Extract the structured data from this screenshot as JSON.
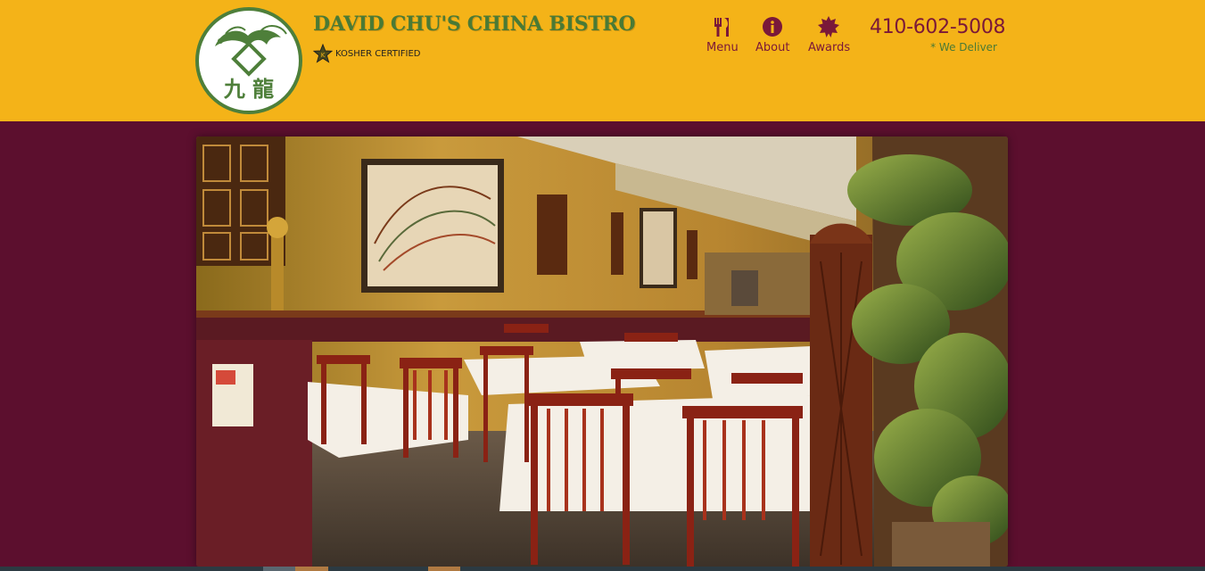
{
  "header": {
    "brand": "DAVID CHU'S CHINA BISTRO",
    "badge": "KOSHER CERTIFIED",
    "phone": "410-602-5008",
    "delivery_note": "* We Deliver"
  },
  "nav": [
    {
      "label": "Menu",
      "icon": "utensils-icon"
    },
    {
      "label": "About",
      "icon": "info-icon"
    },
    {
      "label": "Awards",
      "icon": "award-burst-icon"
    }
  ],
  "logo": {
    "glyphs": "九 龍"
  },
  "hero": {
    "alt": "restaurant dining room"
  },
  "colors": {
    "header_bg": "#f4b318",
    "page_bg": "#5c0f2e",
    "brand_green": "#4a7a35",
    "accent_maroon": "#7a1839"
  }
}
